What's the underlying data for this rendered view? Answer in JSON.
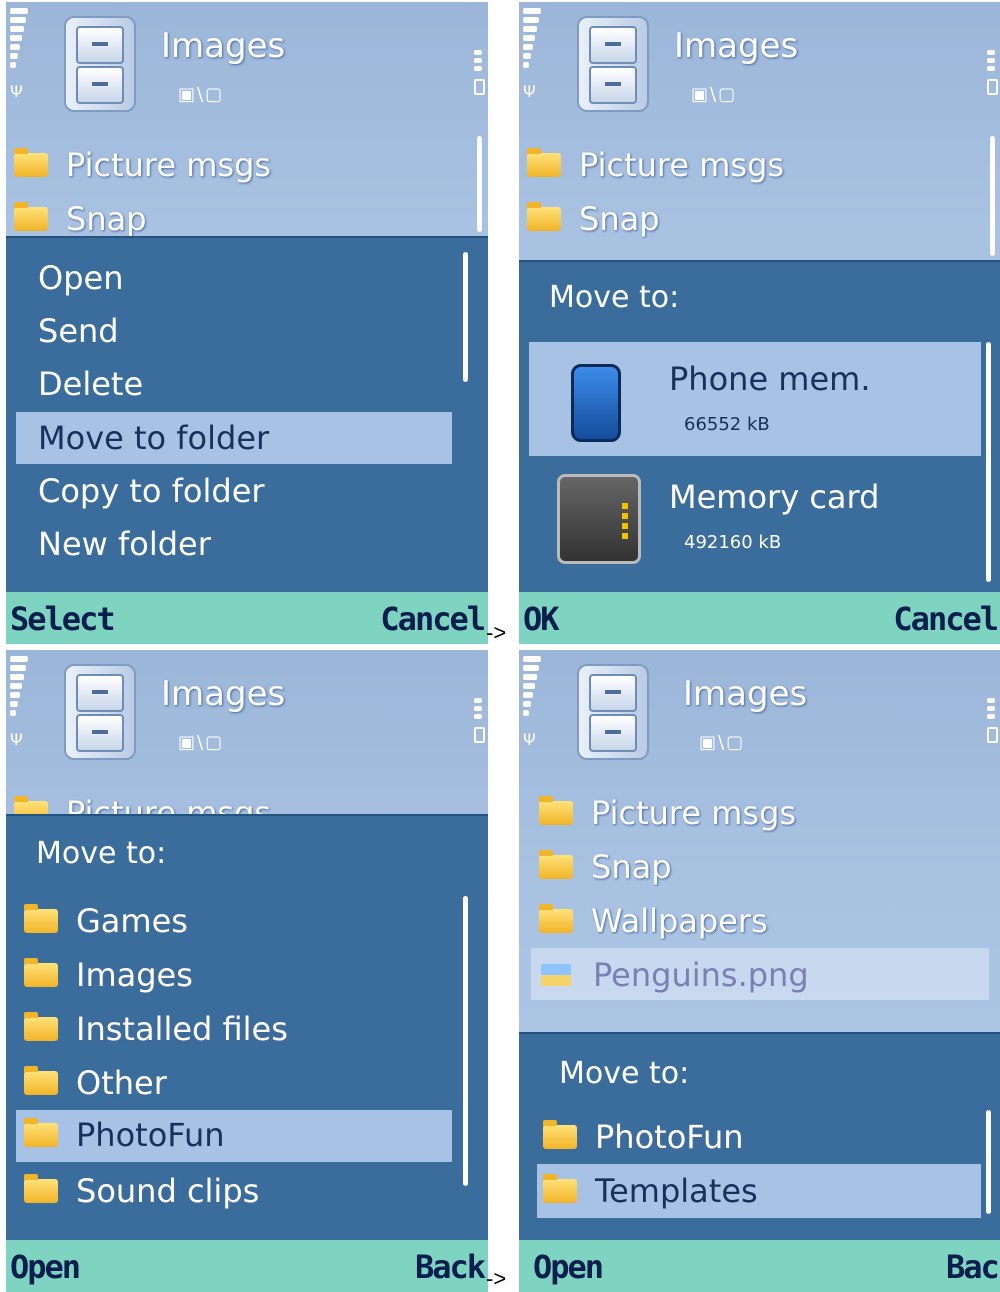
{
  "app_title": "Images",
  "subtitle": "▣\\▢",
  "colors": {
    "softbar": "#7fd3c1",
    "popup": "#3a6d9b",
    "highlight": "#a7c2e4"
  },
  "screen1": {
    "folders": [
      "Picture msgs",
      "Snap"
    ],
    "menu": [
      "Open",
      "Send",
      "Delete",
      "Move to folder",
      "Copy to folder",
      "New folder"
    ],
    "selected_menu": "Move to folder",
    "softkey_left": "Select",
    "softkey_right": "Cancel"
  },
  "screen2": {
    "folders": [
      "Picture msgs",
      "Snap"
    ],
    "move_to_label": "Move to:",
    "destinations": [
      {
        "name": "Phone mem.",
        "size": "66552 kB"
      },
      {
        "name": "Memory card",
        "size": "492160 kB"
      }
    ],
    "softkey_left": "OK",
    "softkey_right": "Cancel"
  },
  "screen3": {
    "partial_folder": "Picture msgs",
    "move_to_label": "Move to:",
    "folders": [
      "Games",
      "Images",
      "Installed files",
      "Other",
      "PhotoFun",
      "Sound clips"
    ],
    "selected": "PhotoFun",
    "softkey_left": "Open",
    "softkey_right": "Back"
  },
  "screen4": {
    "folders": [
      "Picture msgs",
      "Snap",
      "Wallpapers"
    ],
    "file": "Penguins.png",
    "move_to_label": "Move to:",
    "destinations": [
      "PhotoFun",
      "Templates"
    ],
    "selected": "Templates",
    "softkey_left": "Open",
    "softkey_right": "Back"
  },
  "arrows": [
    "->",
    "->"
  ]
}
